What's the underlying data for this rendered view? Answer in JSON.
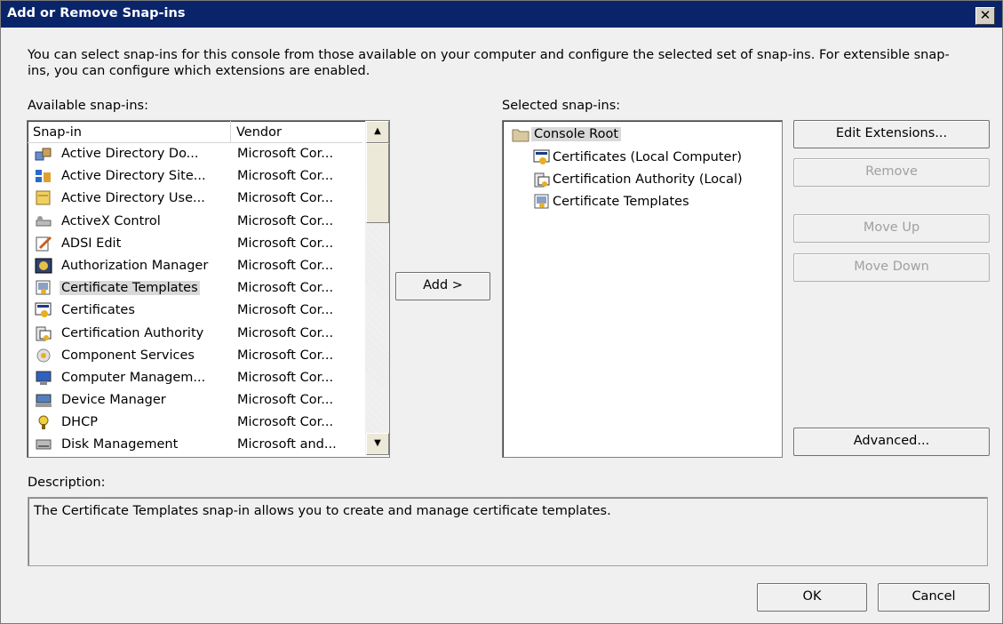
{
  "window": {
    "title": "Add or Remove Snap-ins",
    "close_label": "✕"
  },
  "intro_text": "You can select snap-ins for this console from those available on your computer and configure the selected set of snap-ins. For extensible snap-ins, you can configure which extensions are enabled.",
  "available": {
    "label": "Available snap-ins:",
    "columns": [
      "Snap-in",
      "Vendor"
    ],
    "rows": [
      {
        "name": "Active Directory Do...",
        "vendor": "Microsoft Cor...",
        "icon": "ad-domains-icon"
      },
      {
        "name": "Active Directory Site...",
        "vendor": "Microsoft Cor...",
        "icon": "ad-sites-icon"
      },
      {
        "name": "Active Directory Use...",
        "vendor": "Microsoft Cor...",
        "icon": "ad-users-icon"
      },
      {
        "name": "ActiveX Control",
        "vendor": "Microsoft Cor...",
        "icon": "activex-icon"
      },
      {
        "name": "ADSI Edit",
        "vendor": "Microsoft Cor...",
        "icon": "adsi-edit-icon"
      },
      {
        "name": "Authorization Manager",
        "vendor": "Microsoft Cor...",
        "icon": "authorization-icon"
      },
      {
        "name": "Certificate Templates",
        "vendor": "Microsoft Cor...",
        "icon": "certificate-template-icon",
        "selected": true
      },
      {
        "name": "Certificates",
        "vendor": "Microsoft Cor...",
        "icon": "certificates-icon"
      },
      {
        "name": "Certification Authority",
        "vendor": "Microsoft Cor...",
        "icon": "certification-authority-icon"
      },
      {
        "name": "Component Services",
        "vendor": "Microsoft Cor...",
        "icon": "component-services-icon"
      },
      {
        "name": "Computer Managem...",
        "vendor": "Microsoft Cor...",
        "icon": "computer-management-icon"
      },
      {
        "name": "Device Manager",
        "vendor": "Microsoft Cor...",
        "icon": "device-manager-icon"
      },
      {
        "name": "DHCP",
        "vendor": "Microsoft Cor...",
        "icon": "dhcp-icon"
      },
      {
        "name": "Disk Management",
        "vendor": "Microsoft and...",
        "icon": "disk-management-icon"
      }
    ]
  },
  "add_button": "Add >",
  "selected": {
    "label": "Selected snap-ins:",
    "root": "Console Root",
    "children": [
      "Certificates (Local Computer)",
      "Certification Authority (Local)",
      "Certificate Templates"
    ]
  },
  "buttons": {
    "edit_extensions": "Edit Extensions...",
    "remove": "Remove",
    "move_up": "Move Up",
    "move_down": "Move Down",
    "advanced": "Advanced...",
    "ok": "OK",
    "cancel": "Cancel"
  },
  "description": {
    "label": "Description:",
    "text": "The Certificate Templates snap-in allows you to create and manage certificate templates."
  },
  "colors": {
    "title_bar": "#0a246a",
    "selection": "#d9d9d9"
  }
}
